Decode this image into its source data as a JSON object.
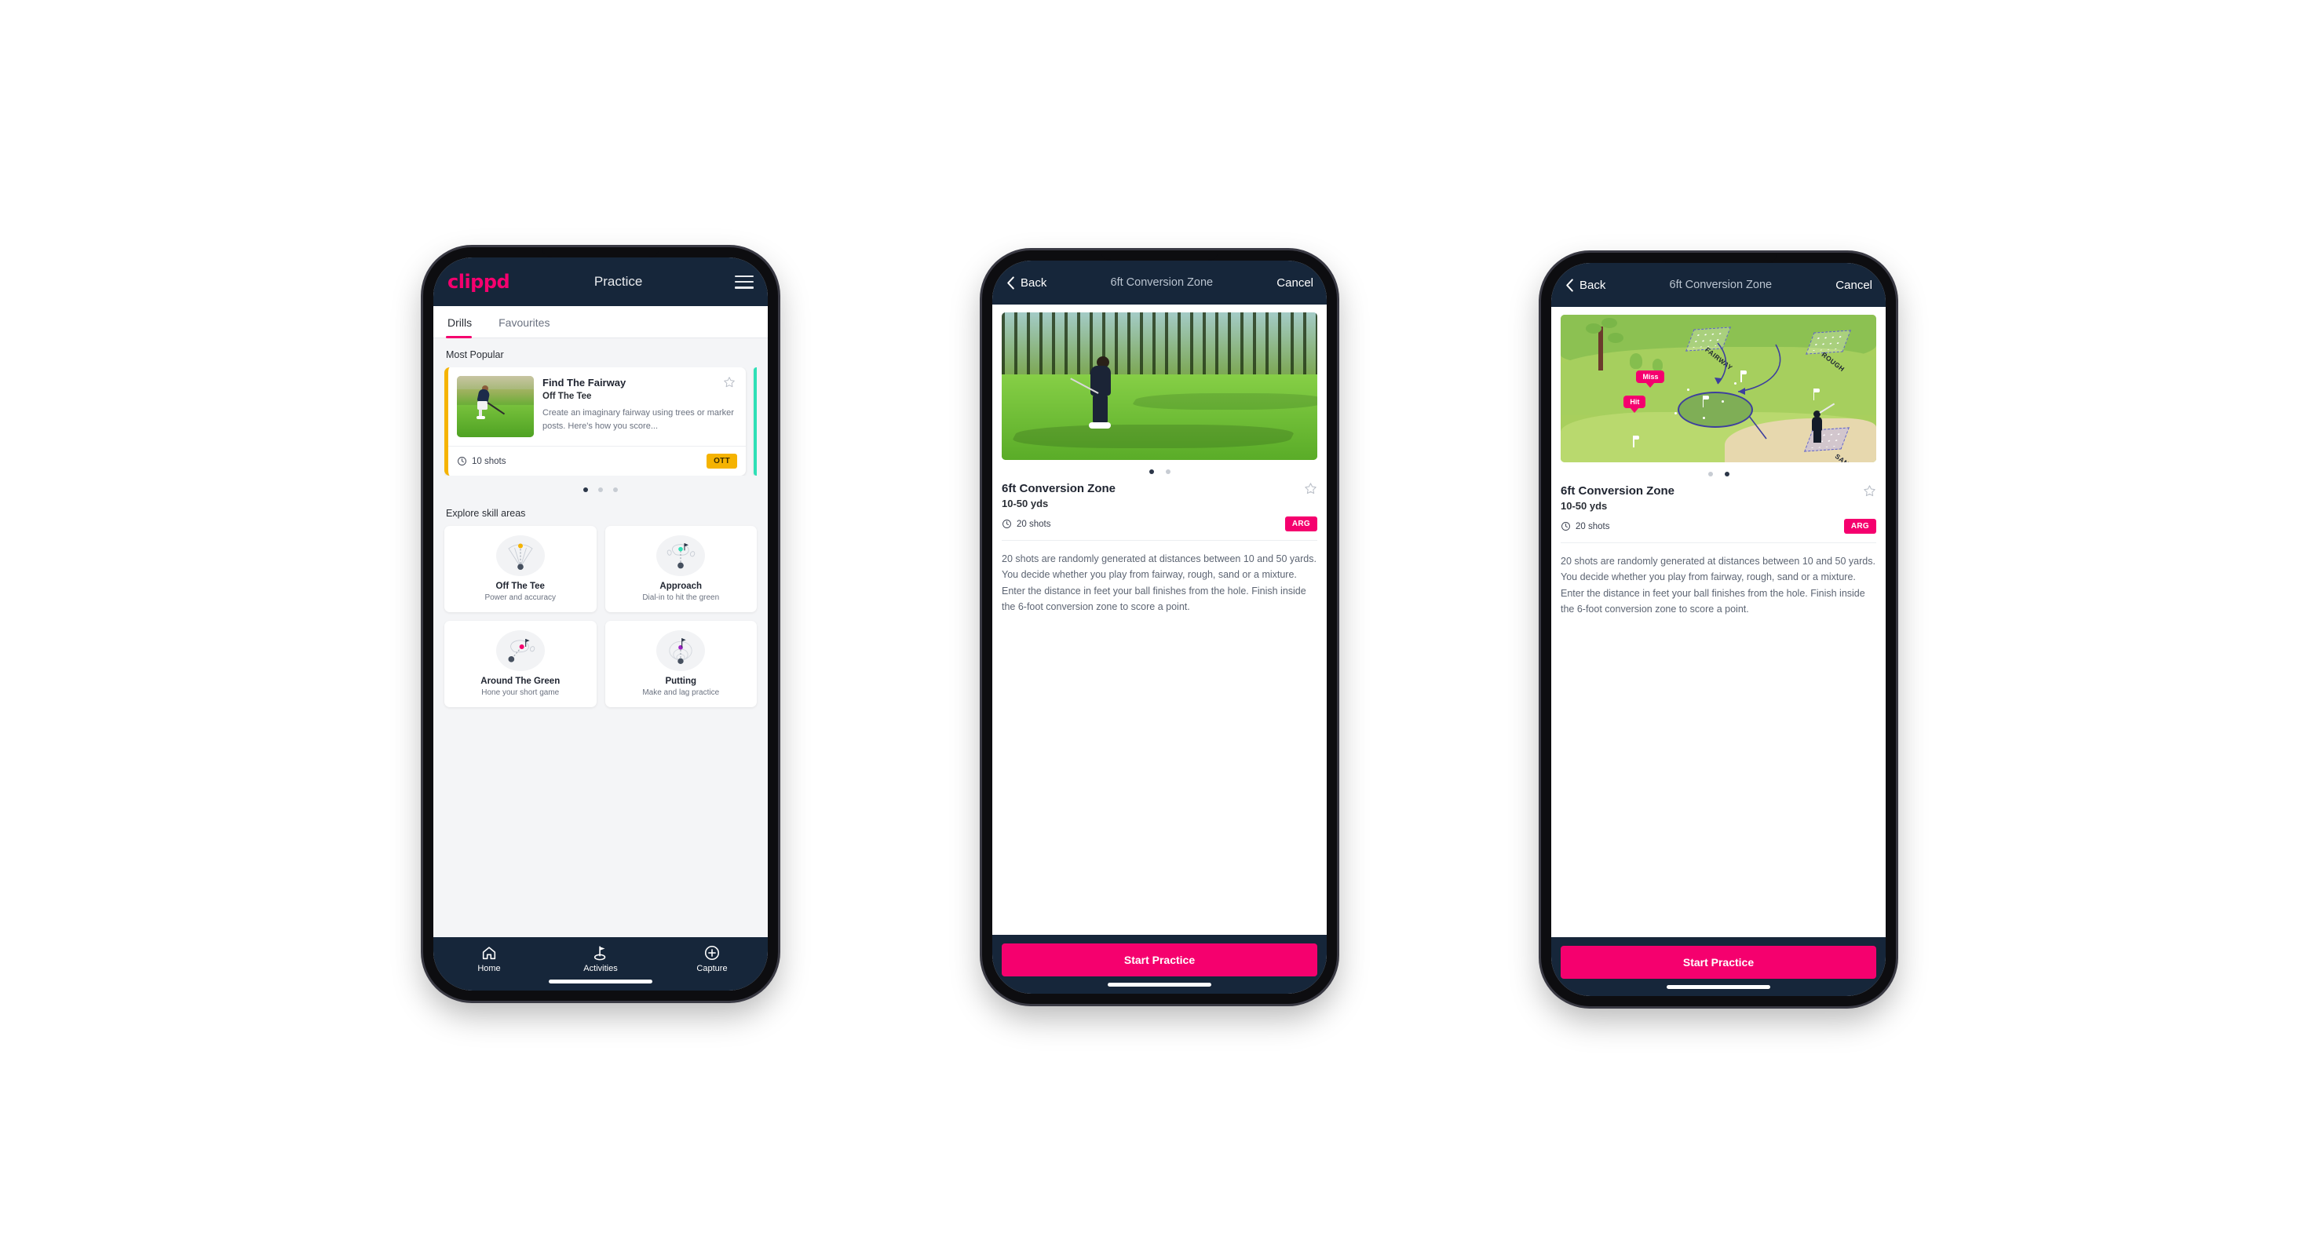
{
  "app": {
    "brand": "clippd",
    "accent_pink": "#f5006e",
    "header_navy": "#16263a",
    "amber": "#f5b301",
    "teal": "#2ee0b6"
  },
  "phone1": {
    "header": {
      "logo": "clippd",
      "title": "Practice",
      "menu_icon": "hamburger-menu-icon"
    },
    "tabs": [
      {
        "label": "Drills",
        "active": true
      },
      {
        "label": "Favourites",
        "active": false
      }
    ],
    "most_popular": {
      "section_label": "Most Popular",
      "card": {
        "title": "Find The Fairway",
        "subtitle": "Off The Tee",
        "description": "Create an imaginary fairway using trees or marker posts. Here's how you score...",
        "shots": "10 shots",
        "badge": "OTT",
        "star_icon": "star-outline-icon",
        "accent": "#f5b301"
      },
      "dots": {
        "count": 3,
        "active_index": 0
      }
    },
    "explore": {
      "section_label": "Explore skill areas",
      "cards": [
        {
          "name": "Off The Tee",
          "desc": "Power and accuracy",
          "icon": "tee-shot-dispersion-icon",
          "dot_color": "#f5b301"
        },
        {
          "name": "Approach",
          "desc": "Dial-in to hit the green",
          "icon": "approach-green-icon",
          "dot_color": "#2ee0b6"
        },
        {
          "name": "Around The Green",
          "desc": "Hone your short game",
          "icon": "chip-around-green-icon",
          "dot_color": "#f5006e"
        },
        {
          "name": "Putting",
          "desc": "Make and lag practice",
          "icon": "putting-rings-icon",
          "dot_color": "#9b1fc4"
        }
      ]
    },
    "bottom_nav": [
      {
        "label": "Home",
        "icon": "home-icon",
        "active": false
      },
      {
        "label": "Activities",
        "icon": "golf-flag-icon",
        "active": true
      },
      {
        "label": "Capture",
        "icon": "plus-circle-icon",
        "active": false
      }
    ]
  },
  "phone2": {
    "header": {
      "back": "Back",
      "title": "6ft Conversion Zone",
      "cancel": "Cancel",
      "back_icon": "chevron-left-icon"
    },
    "hero": {
      "type": "photo",
      "alt": "golfer-chipping-photo"
    },
    "dots": {
      "count": 2,
      "active_index": 0
    },
    "detail": {
      "title": "6ft Conversion Zone",
      "distance": "10-50 yds",
      "shots": "20 shots",
      "badge": "ARG",
      "star_icon": "star-outline-icon",
      "description": "20 shots are randomly generated at distances between 10 and 50 yards. You decide whether you play from fairway, rough, sand or a mixture. Enter the distance in feet your ball finishes from the hole. Finish inside the 6-foot conversion zone to score a point."
    },
    "cta": "Start Practice"
  },
  "phone3": {
    "header": {
      "back": "Back",
      "title": "6ft Conversion Zone",
      "cancel": "Cancel",
      "back_icon": "chevron-left-icon"
    },
    "hero": {
      "type": "illustration",
      "zones": [
        "FAIRWAY",
        "ROUGH",
        "SAND"
      ],
      "tags": [
        "Miss",
        "Hit"
      ]
    },
    "dots": {
      "count": 2,
      "active_index": 1
    },
    "detail": {
      "title": "6ft Conversion Zone",
      "distance": "10-50 yds",
      "shots": "20 shots",
      "badge": "ARG",
      "star_icon": "star-outline-icon",
      "description": "20 shots are randomly generated at distances between 10 and 50 yards. You decide whether you play from fairway, rough, sand or a mixture. Enter the distance in feet your ball finishes from the hole. Finish inside the 6-foot conversion zone to score a point."
    },
    "cta": "Start Practice"
  }
}
